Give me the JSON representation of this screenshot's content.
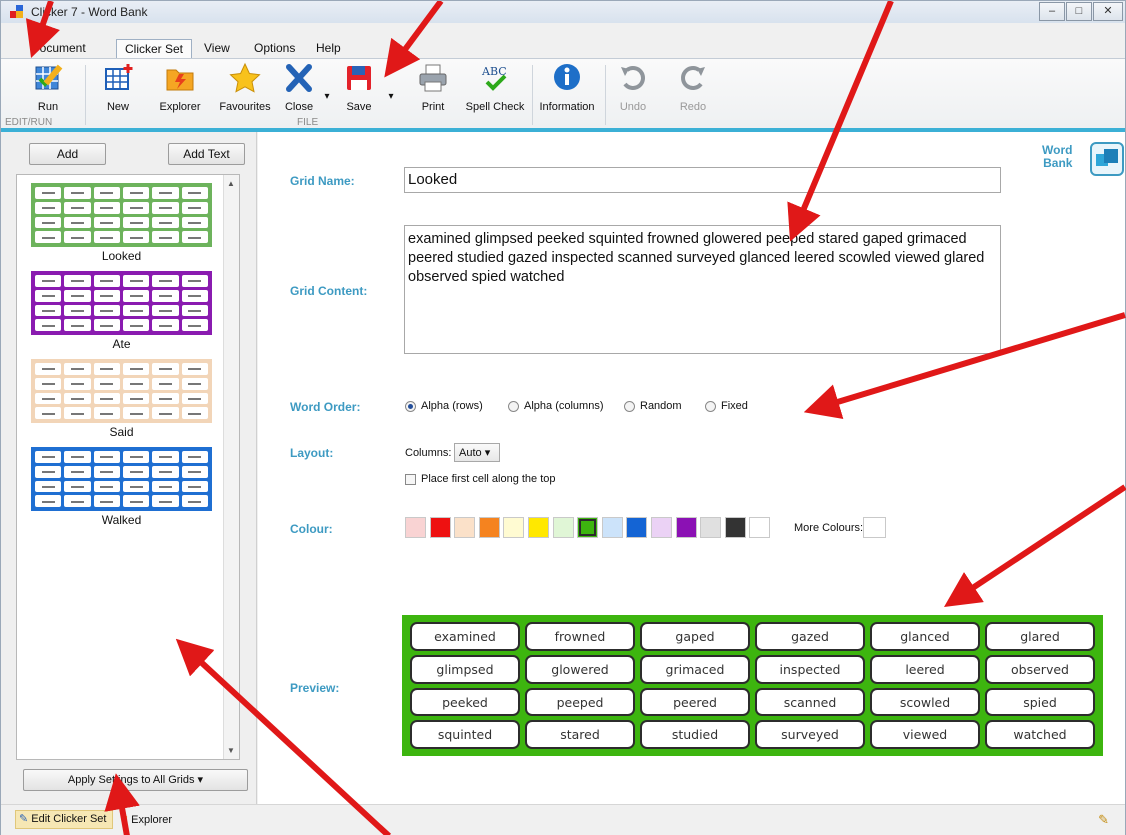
{
  "window": {
    "title": "Clicker 7 - Word Bank"
  },
  "menu": {
    "tabs": [
      "Document",
      "Clicker Set",
      "View",
      "Options",
      "Help"
    ],
    "active": "Clicker Set"
  },
  "ribbon": {
    "buttons": {
      "run": "Run",
      "new": "New",
      "explorer": "Explorer",
      "favourites": "Favourites",
      "close": "Close",
      "save": "Save",
      "print": "Print",
      "spell": "Spell Check",
      "info": "Information",
      "undo": "Undo",
      "redo": "Redo"
    },
    "groups": {
      "editrun": "EDIT/RUN",
      "file": "FILE"
    }
  },
  "left_panel": {
    "add": "Add",
    "add_text": "Add Text",
    "grids": [
      {
        "name": "Looked",
        "color": "#6db35c"
      },
      {
        "name": "Ate",
        "color": "#8a1bb0"
      },
      {
        "name": "Said",
        "color": "#f2d5b8"
      },
      {
        "name": "Walked",
        "color": "#1f6fd2"
      }
    ],
    "apply": "Apply Settings to All Grids"
  },
  "status": {
    "edit": "Edit Clicker Set",
    "explorer": "Explorer"
  },
  "word_bank": {
    "line1": "Word",
    "line2": "Bank"
  },
  "form": {
    "grid_name_label": "Grid Name:",
    "grid_name": "Looked",
    "grid_content_label": "Grid Content:",
    "grid_content": "examined glimpsed peeked squinted frowned glowered peeped stared gaped grimaced peered studied gazed inspected scanned surveyed glanced leered scowled viewed glared observed spied watched",
    "word_order_label": "Word Order:",
    "word_order_options": [
      "Alpha (rows)",
      "Alpha (columns)",
      "Random",
      "Fixed"
    ],
    "word_order_selected": "Alpha (rows)",
    "layout_label": "Layout:",
    "columns_label": "Columns:",
    "columns_value": "Auto",
    "place_first": "Place first cell along the top",
    "colour_label": "Colour:",
    "colours": [
      "#f9d3d3",
      "#ee1111",
      "#fbe1c9",
      "#f5831f",
      "#fffbd2",
      "#ffe800",
      "#e0f6d6",
      "#3db50f",
      "#cce3fa",
      "#1464d4",
      "#ebd2f5",
      "#8b11b4",
      "#e0e0e0",
      "#333333",
      "#ffffff"
    ],
    "selected_colour": "#3db50f",
    "more_colours": "More Colours:",
    "preview_label": "Preview:"
  },
  "preview_words": [
    "examined",
    "frowned",
    "gaped",
    "gazed",
    "glanced",
    "glared",
    "glimpsed",
    "glowered",
    "grimaced",
    "inspected",
    "leered",
    "observed",
    "peeked",
    "peeped",
    "peered",
    "scanned",
    "scowled",
    "spied",
    "squinted",
    "stared",
    "studied",
    "surveyed",
    "viewed",
    "watched"
  ],
  "annotation_color": "#e01818"
}
